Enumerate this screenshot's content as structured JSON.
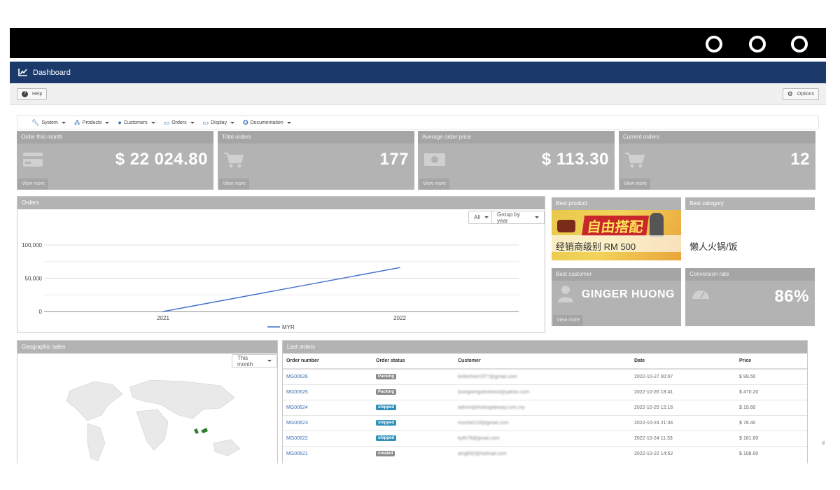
{
  "header": {
    "title": "Dashboard"
  },
  "toolbar": {
    "help_label": "Help",
    "options_label": "Options"
  },
  "menu": [
    {
      "label": "System",
      "icon": "wrench-icon"
    },
    {
      "label": "Products",
      "icon": "cubes-icon"
    },
    {
      "label": "Customers",
      "icon": "user-icon"
    },
    {
      "label": "Orders",
      "icon": "credit-card-icon"
    },
    {
      "label": "Display",
      "icon": "desktop-icon"
    },
    {
      "label": "Documentation",
      "icon": "lifebuoy-icon"
    }
  ],
  "stats": [
    {
      "title": "Order this month",
      "value": "$ 22 024.80",
      "link": "View more",
      "icon": "credit-card-icon"
    },
    {
      "title": "Total orders",
      "value": "177",
      "link": "View more",
      "icon": "cart-icon"
    },
    {
      "title": "Average order price",
      "value": "$ 113.30",
      "link": "View more",
      "icon": "money-icon"
    },
    {
      "title": "Current orders",
      "value": "12",
      "link": "View more",
      "icon": "cart-icon"
    }
  ],
  "orders_panel": {
    "title": "Orders",
    "filter_all": "All",
    "group_by": "Group by year"
  },
  "chart_data": {
    "type": "line",
    "title": "",
    "x": [
      "2021",
      "2022"
    ],
    "series": [
      {
        "name": "MYR",
        "values": [
          0,
          66000
        ],
        "color": "#3f6ecb"
      }
    ],
    "ylim": [
      0,
      100000
    ],
    "yticks": [
      "0",
      "50,000",
      "100,000"
    ],
    "grid": true,
    "legend": "bottom"
  },
  "best_product": {
    "title": "Best product",
    "name": "经销商级别 RM 500",
    "banner_text": "自由搭配"
  },
  "best_category": {
    "title": "Best category",
    "name": "懒人火锅/饭"
  },
  "best_customer": {
    "title": "Best customer",
    "name": "GINGER HUONG",
    "link": "View more"
  },
  "conversion": {
    "title": "Conversion rate",
    "value": "86%"
  },
  "geo": {
    "title": "Geographic sales",
    "period": "This month"
  },
  "last_orders": {
    "title": "Last orders",
    "columns": [
      "Order number",
      "Order status",
      "Customer",
      "Date",
      "Price"
    ],
    "rows": [
      {
        "number": "MG00626",
        "status": "Packing",
        "status_color": "#8a8a8a",
        "customer": "limfechee1977@gmail.com",
        "date": "2022-10-27 00:07",
        "price": "$ 99.50"
      },
      {
        "number": "MG00625",
        "status": "Packing",
        "status_color": "#8a8a8a",
        "customer": "loongsengsteshene@yahoo.com",
        "date": "2022-10-26 18:41",
        "price": "$ 470.20"
      },
      {
        "number": "MG00624",
        "status": "shipped",
        "status_color": "#2f8fb8",
        "customer": "admin@etstergateway.com.my",
        "date": "2022-10-25 12:16",
        "price": "$ 19.60"
      },
      {
        "number": "MG00623",
        "status": "shipped",
        "status_color": "#2f8fb8",
        "customer": "mochel118@gmail.com",
        "date": "2022-10-24 21:34",
        "price": "$ 78.40"
      },
      {
        "number": "MG00622",
        "status": "shipped",
        "status_color": "#2f8fb8",
        "customer": "kyth79@gmail.com",
        "date": "2022-10-24 11:33",
        "price": "$ 181.60"
      },
      {
        "number": "MG00621",
        "status": "created",
        "status_color": "#8a8a8a",
        "customer": "alng832@hotmail.com",
        "date": "2022-10-22 14:52",
        "price": "$ 108.00"
      }
    ]
  },
  "edge_label": "d"
}
